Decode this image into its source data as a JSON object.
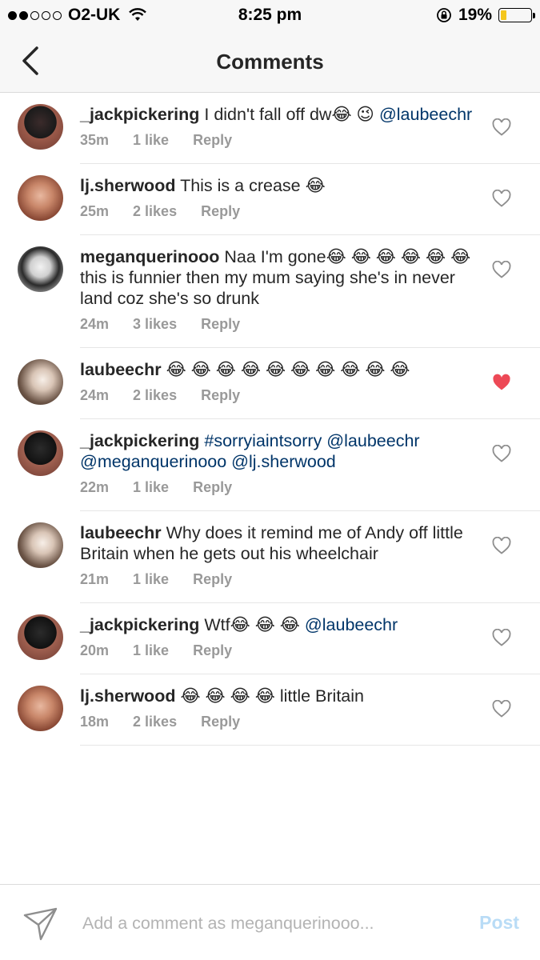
{
  "status_bar": {
    "carrier": "O2-UK",
    "time": "8:25 pm",
    "battery": "19%",
    "battery_level": 0.19,
    "signal_dots_filled": 2,
    "signal_dots_total": 5,
    "icons": [
      "wifi-icon",
      "rotation-lock-icon",
      "battery-icon"
    ]
  },
  "header": {
    "title": "Comments",
    "back_icon": "chevron-left-icon"
  },
  "colors": {
    "mention": "#003569",
    "meta": "#999999",
    "liked_heart": "#ed4956",
    "post_button_disabled": "#b9dcf6"
  },
  "comments": [
    {
      "username": "_jackpickering",
      "text": "I didn't fall off dw😂 😉",
      "mention": "@laubeechr",
      "time": "35m",
      "likes": "1 like",
      "reply": "Reply",
      "liked": false
    },
    {
      "username": "lj.sherwood",
      "text": "This is a crease 😂",
      "mention": "",
      "time": "25m",
      "likes": "2 likes",
      "reply": "Reply",
      "liked": false
    },
    {
      "username": "meganquerinooo",
      "text": "Naa I'm gone😂 😂 😂 😂 😂 😂 this is funnier then my mum saying she's in never land coz she's so drunk",
      "mention": "",
      "time": "24m",
      "likes": "3 likes",
      "reply": "Reply",
      "liked": false
    },
    {
      "username": "laubeechr",
      "text": "😂 😂 😂 😂 😂 😂 😂 😂 😂 😂",
      "mention": "",
      "time": "24m",
      "likes": "2 likes",
      "reply": "Reply",
      "liked": true
    },
    {
      "username": "_jackpickering",
      "text": "",
      "mention": "#sorryiaintsorry @laubeechr @meganquerinooo @lj.sherwood",
      "time": "22m",
      "likes": "1 like",
      "reply": "Reply",
      "liked": false
    },
    {
      "username": "laubeechr",
      "text": "Why does it remind me of Andy off little Britain when he gets out his wheelchair",
      "mention": "",
      "time": "21m",
      "likes": "1 like",
      "reply": "Reply",
      "liked": false
    },
    {
      "username": "_jackpickering",
      "text": "Wtf😂 😂 😂",
      "mention": "@laubeechr",
      "time": "20m",
      "likes": "1 like",
      "reply": "Reply",
      "liked": false
    },
    {
      "username": "lj.sherwood",
      "text": "😂 😂 😂 😂 little Britain",
      "mention": "",
      "time": "18m",
      "likes": "2 likes",
      "reply": "Reply",
      "liked": false
    }
  ],
  "composer": {
    "placeholder": "Add a comment as meganquerinooo...",
    "value": "",
    "post_label": "Post",
    "send_icon": "paper-plane-icon"
  }
}
